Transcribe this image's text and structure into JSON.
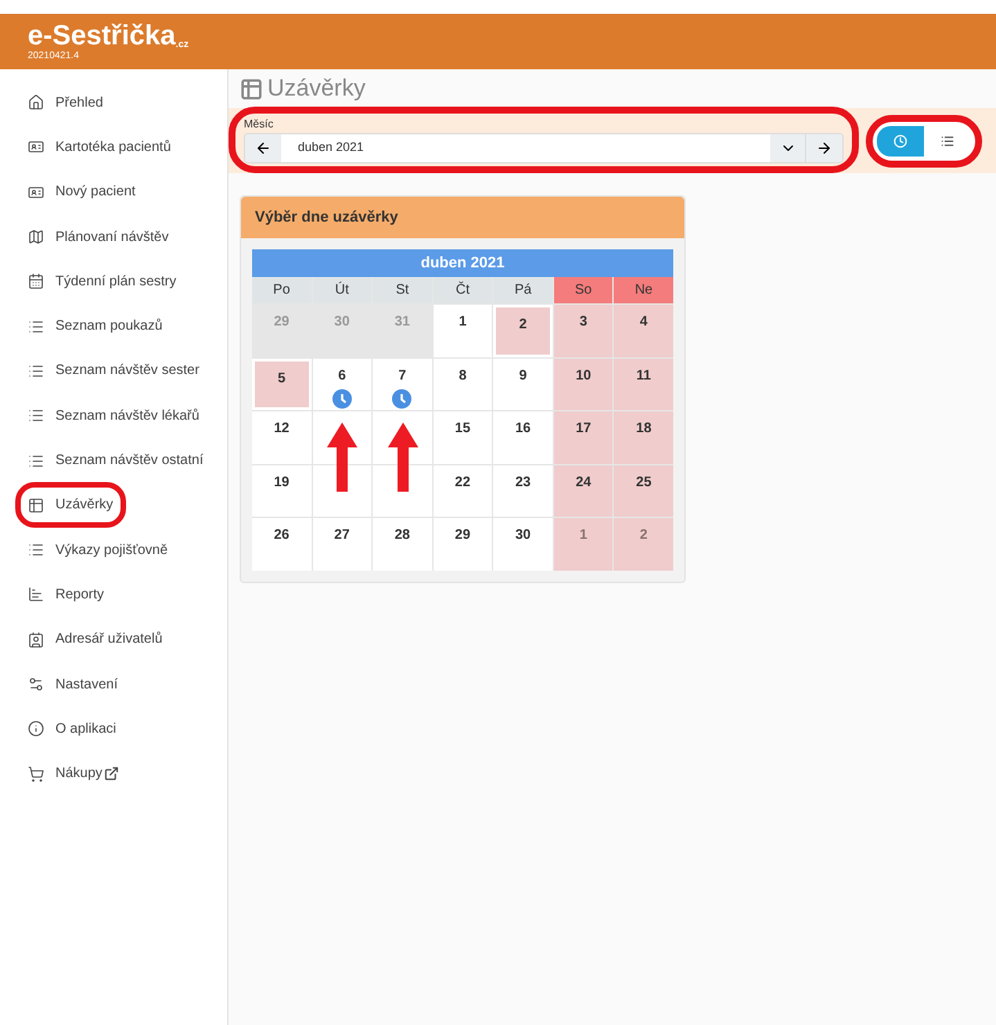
{
  "header": {
    "logo": "e-Sestřička",
    "logo_suffix": ".cz",
    "version": "20210421.4"
  },
  "sidebar": {
    "items": [
      {
        "label": "Přehled",
        "circled": false,
        "external": false
      },
      {
        "label": "Kartotéka pacientů",
        "circled": false,
        "external": false
      },
      {
        "label": "Nový pacient",
        "circled": false,
        "external": false
      },
      {
        "label": "Plánovaní návštěv",
        "circled": false,
        "external": false
      },
      {
        "label": "Týdenní plán sestry",
        "circled": false,
        "external": false
      },
      {
        "label": "Seznam poukazů",
        "circled": false,
        "external": false
      },
      {
        "label": "Seznam návštěv sester",
        "circled": false,
        "external": false
      },
      {
        "label": "Seznam návštěv lékařů",
        "circled": false,
        "external": false
      },
      {
        "label": "Seznam návštěv ostatní",
        "circled": false,
        "external": false
      },
      {
        "label": "Uzávěrky",
        "circled": true,
        "external": false
      },
      {
        "label": "Výkazy pojišťovně",
        "circled": false,
        "external": false
      },
      {
        "label": "Reporty",
        "circled": false,
        "external": false
      },
      {
        "label": "Adresář uživatelů",
        "circled": false,
        "external": false
      },
      {
        "label": "Nastavení",
        "circled": false,
        "external": false
      },
      {
        "label": "O aplikaci",
        "circled": false,
        "external": false
      },
      {
        "label": "Nákupy",
        "circled": false,
        "external": true
      }
    ]
  },
  "page_title": "Uzávěrky",
  "month_filter": {
    "label": "Měsíc",
    "value": "duben 2021"
  },
  "views": [
    {
      "kind": "calendar",
      "selected": true
    },
    {
      "kind": "list",
      "selected": false
    }
  ],
  "card": {
    "title": "Výběr dne uzávěrky",
    "calendar": {
      "title": "duben 2021",
      "weekdays": [
        {
          "label": "Po",
          "weekend": false
        },
        {
          "label": "Út",
          "weekend": false
        },
        {
          "label": "St",
          "weekend": false
        },
        {
          "label": "Čt",
          "weekend": false
        },
        {
          "label": "Pá",
          "weekend": false
        },
        {
          "label": "So",
          "weekend": true
        },
        {
          "label": "Ne",
          "weekend": true
        }
      ],
      "weeks": [
        [
          {
            "day": "29",
            "kind": "outside",
            "closure": false
          },
          {
            "day": "30",
            "kind": "outside",
            "closure": false
          },
          {
            "day": "31",
            "kind": "outside",
            "closure": false
          },
          {
            "day": "1",
            "kind": "normal",
            "closure": false
          },
          {
            "day": "2",
            "kind": "holiday",
            "closure": false
          },
          {
            "day": "3",
            "kind": "weekend",
            "closure": false
          },
          {
            "day": "4",
            "kind": "weekend",
            "closure": false
          }
        ],
        [
          {
            "day": "5",
            "kind": "holiday",
            "closure": false
          },
          {
            "day": "6",
            "kind": "normal",
            "closure": true
          },
          {
            "day": "7",
            "kind": "normal",
            "closure": true
          },
          {
            "day": "8",
            "kind": "normal",
            "closure": false
          },
          {
            "day": "9",
            "kind": "normal",
            "closure": false
          },
          {
            "day": "10",
            "kind": "weekend",
            "closure": false
          },
          {
            "day": "11",
            "kind": "weekend",
            "closure": false
          }
        ],
        [
          {
            "day": "12",
            "kind": "normal",
            "closure": false
          },
          {
            "kind": "normal",
            "closure": false
          },
          {
            "kind": "normal",
            "closure": false
          },
          {
            "day": "15",
            "kind": "normal",
            "closure": false
          },
          {
            "day": "16",
            "kind": "normal",
            "closure": false
          },
          {
            "day": "17",
            "kind": "weekend",
            "closure": false
          },
          {
            "day": "18",
            "kind": "weekend",
            "closure": false
          }
        ],
        [
          {
            "day": "19",
            "kind": "normal",
            "closure": false
          },
          {
            "kind": "normal",
            "closure": false
          },
          {
            "kind": "normal",
            "closure": false
          },
          {
            "day": "22",
            "kind": "normal",
            "closure": false
          },
          {
            "day": "23",
            "kind": "normal",
            "closure": false
          },
          {
            "day": "24",
            "kind": "weekend",
            "closure": false
          },
          {
            "day": "25",
            "kind": "weekend",
            "closure": false
          }
        ],
        [
          {
            "day": "26",
            "kind": "normal",
            "closure": false
          },
          {
            "day": "27",
            "kind": "normal",
            "closure": false
          },
          {
            "day": "28",
            "kind": "normal",
            "closure": false
          },
          {
            "day": "29",
            "kind": "normal",
            "closure": false
          },
          {
            "day": "30",
            "kind": "normal",
            "closure": false
          },
          {
            "day": "1",
            "kind": "outside-weekend",
            "closure": false
          },
          {
            "day": "2",
            "kind": "outside-weekend",
            "closure": false
          }
        ]
      ]
    }
  }
}
